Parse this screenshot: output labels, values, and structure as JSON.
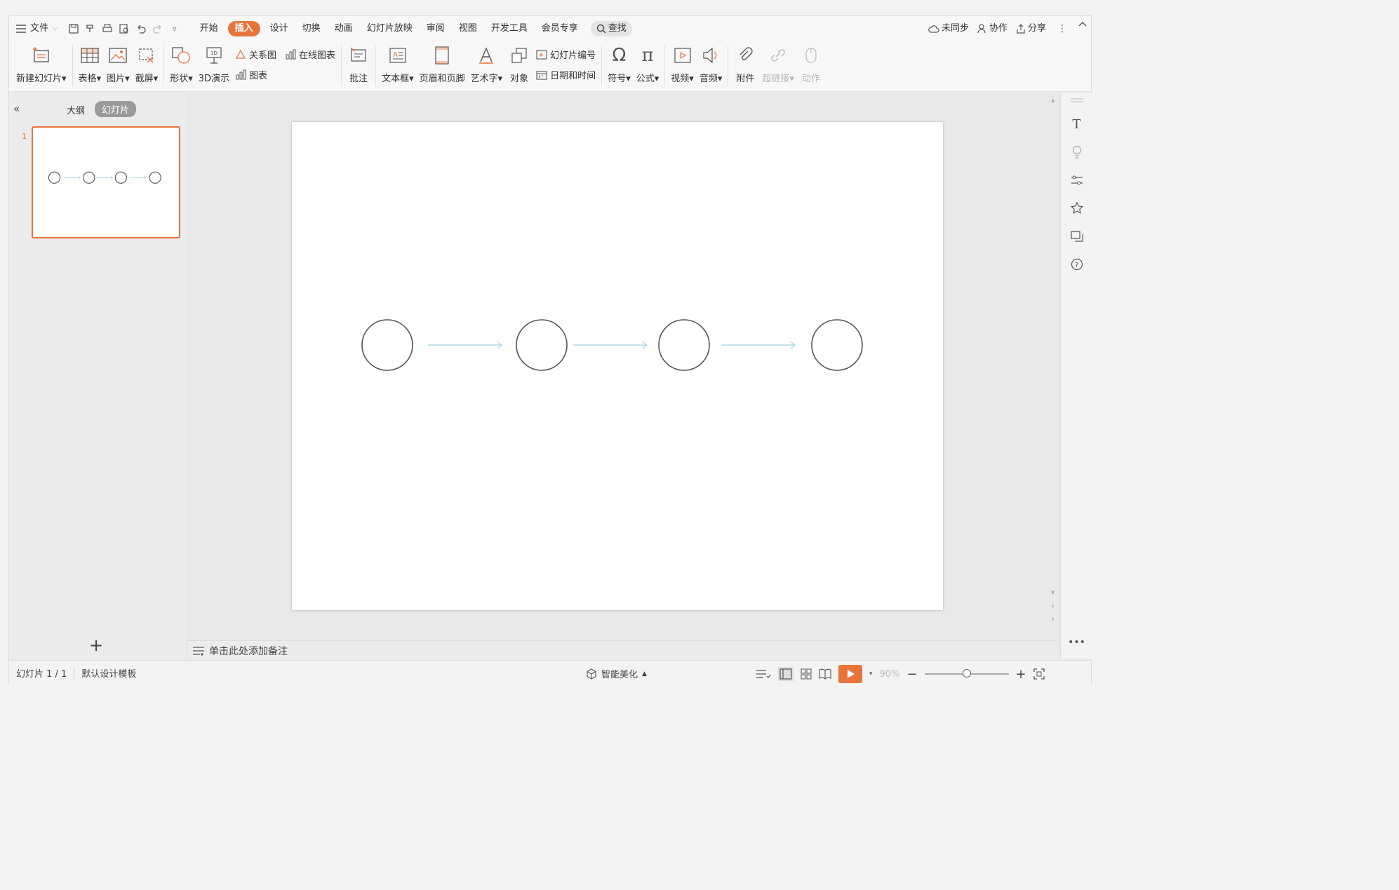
{
  "menubar": {
    "file_label": "文件",
    "tabs": [
      {
        "label": "开始",
        "active": false
      },
      {
        "label": "插入",
        "active": true
      },
      {
        "label": "设计",
        "active": false
      },
      {
        "label": "切换",
        "active": false
      },
      {
        "label": "动画",
        "active": false
      },
      {
        "label": "幻灯片放映",
        "active": false
      },
      {
        "label": "审阅",
        "active": false
      },
      {
        "label": "视图",
        "active": false
      },
      {
        "label": "开发工具",
        "active": false
      },
      {
        "label": "会员专享",
        "active": false
      }
    ],
    "search_label": "查找",
    "sync_label": "未同步",
    "collab_label": "协作",
    "share_label": "分享"
  },
  "ribbon": {
    "new_slide": "新建幻灯片",
    "table": "表格",
    "picture": "图片",
    "screenshot": "截屏",
    "shape": "形状",
    "demo3d": "3D演示",
    "relation": "关系图",
    "online_chart": "在线图表",
    "chart": "图表",
    "comment": "批注",
    "textbox": "文本框",
    "header_footer": "页眉和页脚",
    "wordart": "艺术字",
    "object": "对象",
    "slide_number": "幻灯片编号",
    "date_time": "日期和时间",
    "symbol": "符号",
    "formula": "公式",
    "video": "视频",
    "audio": "音频",
    "attachment": "附件",
    "hyperlink": "超链接",
    "action": "动作"
  },
  "leftpanel": {
    "tab_outline": "大纲",
    "tab_slides": "幻灯片",
    "slide_number": "1",
    "add_symbol": "+"
  },
  "slide": {
    "circle_count": 4,
    "circle_stroke": "#555555",
    "arrow_color": "#a8d8e0"
  },
  "notes": {
    "placeholder": "单击此处添加备注"
  },
  "status": {
    "slide_counter": "幻灯片 1 / 1",
    "template": "默认设计模板",
    "beautify": "智能美化",
    "zoom": "90%"
  },
  "colors": {
    "accent": "#e8743b"
  }
}
